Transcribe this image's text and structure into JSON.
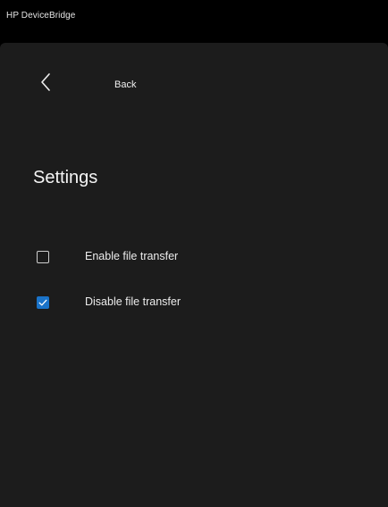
{
  "window": {
    "title": "HP DeviceBridge"
  },
  "nav": {
    "back_label": "Back",
    "back_icon": "chevron-left-icon"
  },
  "page": {
    "title": "Settings"
  },
  "options": [
    {
      "label": "Enable file transfer",
      "checked": false
    },
    {
      "label": "Disable file transfer",
      "checked": true
    }
  ],
  "colors": {
    "background": "#1c1c1c",
    "titlebar": "#000000",
    "accent": "#1a73c9",
    "text": "#ffffff"
  }
}
